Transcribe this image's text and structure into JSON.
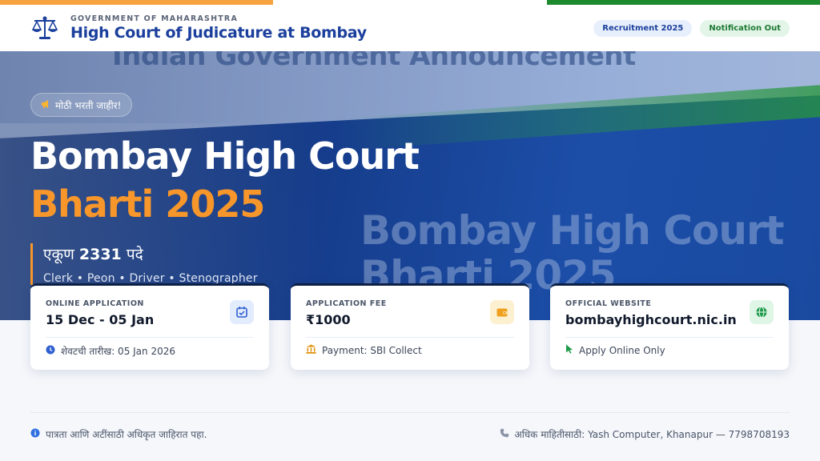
{
  "colors": {
    "saffron": "#f7a440",
    "green": "#1e8a2e",
    "brand_blue": "#1b3f9c",
    "accent_orange": "#f7962a",
    "hero_blue": "#163d8c"
  },
  "header": {
    "org_label": "GOVERNMENT OF MAHARASHTRA",
    "title": "High Court of Judicature at Bombay",
    "logo_icon": "scales-of-justice-icon",
    "pills": [
      {
        "label": "Recruitment 2025"
      },
      {
        "label": "Notification Out"
      }
    ]
  },
  "hero": {
    "bg_text_top": "Indian Government                    Announcement",
    "bg_text_big_1": "Bombay High Court",
    "bg_text_big_2": "Bharti 2025",
    "tag_icon": "megaphone-icon",
    "tag": "मोठी भरती जाहीर!",
    "title_line1": "Bombay High Court",
    "title_line2": "Bharti 2025",
    "posts_prefix": "एकूण",
    "posts_count": "2331",
    "posts_suffix": "पदे",
    "roles": "Clerk • Peon • Driver • Stenographer"
  },
  "cards": [
    {
      "label": "ONLINE APPLICATION",
      "value": "15 Dec - 05 Jan",
      "icon": "calendar-check-icon",
      "footer_icon": "clock-icon",
      "footer": "शेवटची तारीख: 05 Jan 2026"
    },
    {
      "label": "APPLICATION FEE",
      "value": "₹1000",
      "icon": "wallet-icon",
      "footer_icon": "bank-icon",
      "footer": "Payment: SBI Collect"
    },
    {
      "label": "OFFICIAL WEBSITE",
      "value": "bombayhighcourt.nic.in",
      "icon": "globe-icon",
      "footer_icon": "cursor-icon",
      "footer": "Apply Online Only"
    }
  ],
  "footer": {
    "left_icon": "info-icon",
    "left": "पात्रता आणि अटींसाठी अधिकृत जाहिरात पहा.",
    "right_icon": "phone-icon",
    "right": "अधिक माहितीसाठी: Yash Computer, Khanapur — 7798708193"
  }
}
